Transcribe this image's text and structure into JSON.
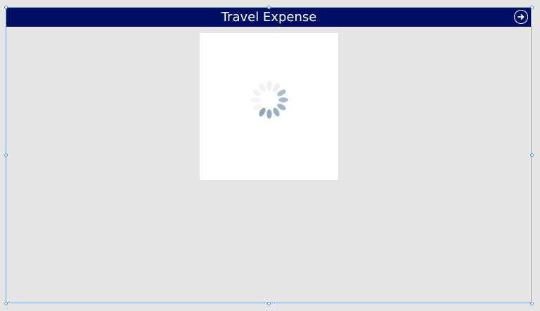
{
  "app": {
    "title": "Travel Expense"
  },
  "header": {
    "background_color": "#000f63",
    "next_icon": "arrow-right-circle-icon"
  },
  "content": {
    "state": "loading",
    "spinner_icon": "loading-spinner-icon"
  },
  "colors": {
    "canvas": "#e6e6e6",
    "card": "#ffffff",
    "selection": "#7aa7d6",
    "spinner_dark": "#8fa6bd",
    "spinner_light": "#e3e9ef"
  }
}
